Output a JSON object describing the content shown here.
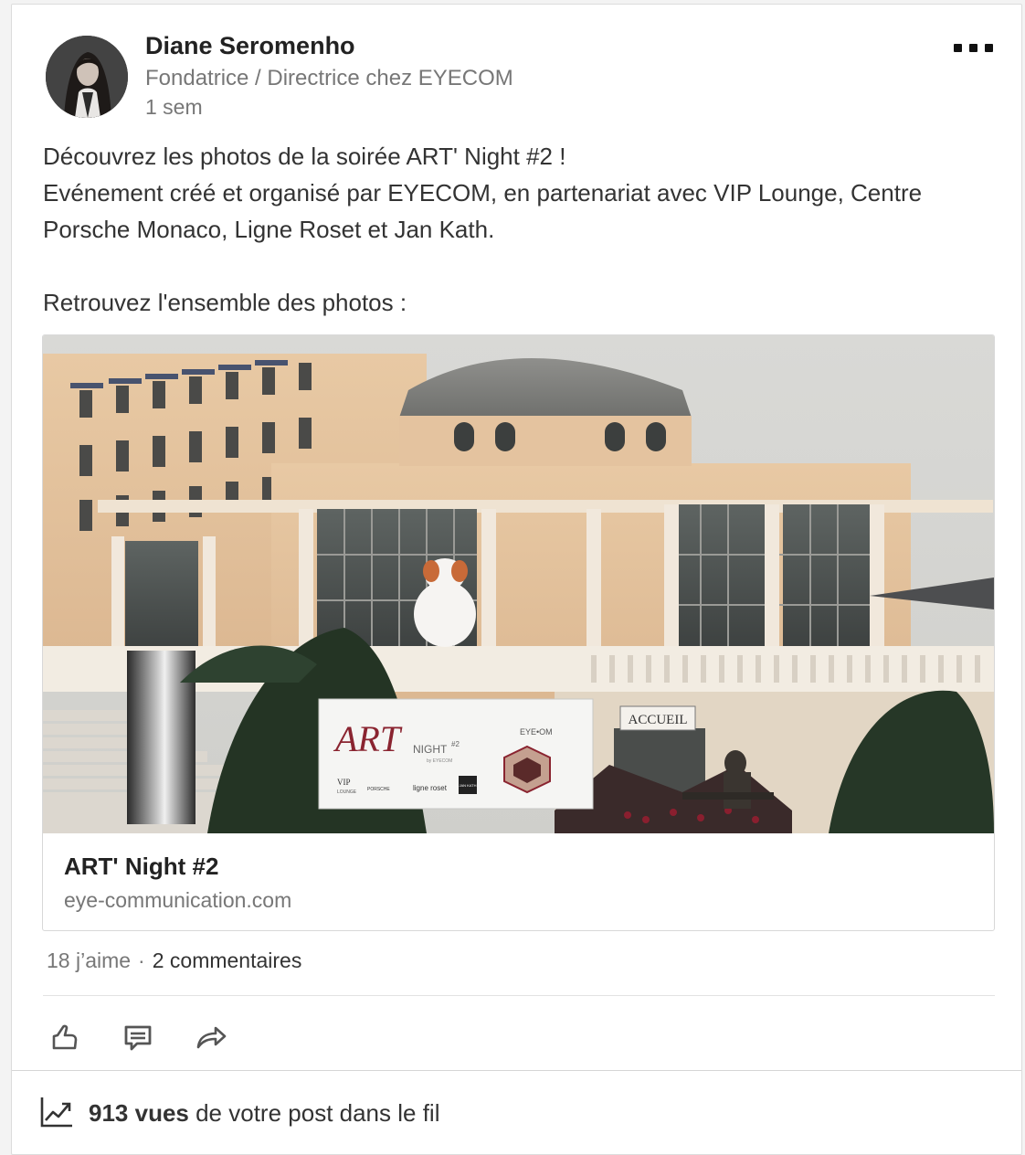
{
  "author": {
    "name": "Diane Seromenho",
    "title": "Fondatrice / Directrice chez EYECOM",
    "time": "1 sem"
  },
  "post": {
    "lines": [
      "Découvrez les photos de la soirée ART' Night #2 !",
      "Evénement créé et organisé par EYECOM, en partenariat avec VIP Lounge, Centre",
      "Porsche Monaco, Ligne Roset et Jan Kath.",
      "Retrouvez l'ensemble des photos :"
    ]
  },
  "link": {
    "title": "ART' Night #2",
    "domain": "eye-communication.com",
    "image": {
      "banner_title": "ART",
      "banner_sub": "NIGHT",
      "banner_edition": "#2",
      "banner_by": "by EYECOM",
      "banner_org": "EYE•OM",
      "banner_sponsor_1": "VIP",
      "banner_sponsor_1b": "LOUNGE",
      "banner_sponsor_2": "PORSCHE",
      "banner_sponsor_3": "ligne roset",
      "banner_sponsor_4": "JAN KATH",
      "sign": "ACCUEIL"
    }
  },
  "stats": {
    "likes": "18 j’aime",
    "separator": "·",
    "comments": "2 commentaires"
  },
  "actions": {
    "like_icon": "thumbs-up-icon",
    "comment_icon": "comment-icon",
    "share_icon": "share-icon"
  },
  "views": {
    "icon": "trending-chart-icon",
    "count": "913 vues",
    "suffix": " de votre post dans le fil"
  },
  "colors": {
    "text": "#333333",
    "muted": "#777777",
    "border": "#dcdcdc"
  }
}
